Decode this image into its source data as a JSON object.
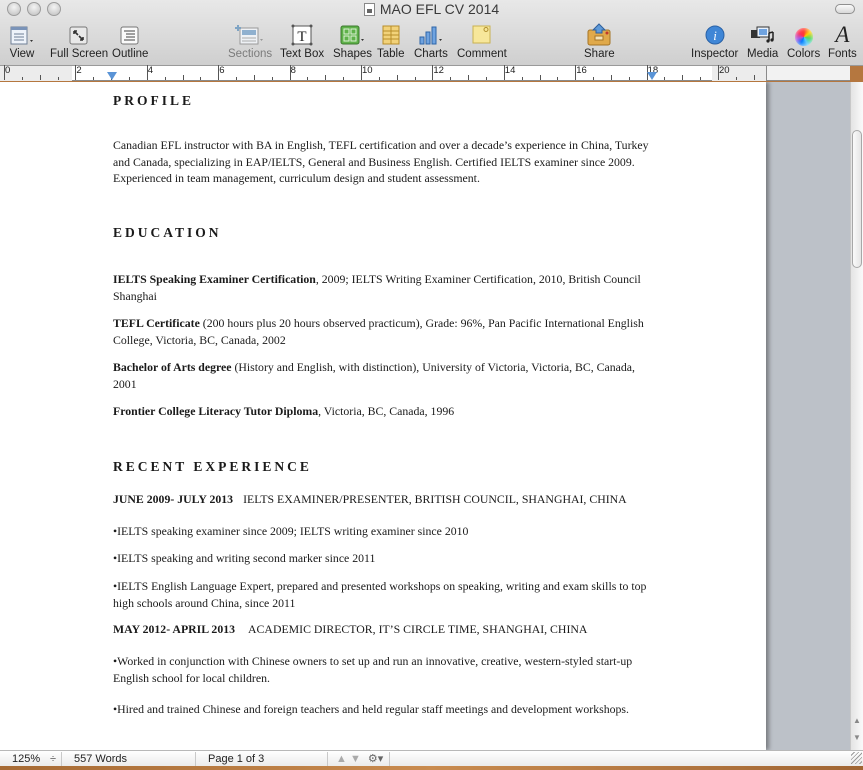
{
  "window": {
    "title": "MAO EFL CV 2014"
  },
  "toolbar": {
    "items": [
      {
        "id": "view",
        "label": "View",
        "icon": "view-icon"
      },
      {
        "id": "full-screen",
        "label": "Full Screen",
        "icon": "full-screen-icon"
      },
      {
        "id": "outline",
        "label": "Outline",
        "icon": "outline-icon"
      },
      {
        "id": "sections",
        "label": "Sections",
        "icon": "sections-icon",
        "disabled": true
      },
      {
        "id": "text-box",
        "label": "Text Box",
        "icon": "text-box-icon"
      },
      {
        "id": "shapes",
        "label": "Shapes",
        "icon": "shapes-icon"
      },
      {
        "id": "table",
        "label": "Table",
        "icon": "table-icon"
      },
      {
        "id": "charts",
        "label": "Charts",
        "icon": "charts-icon"
      },
      {
        "id": "comment",
        "label": "Comment",
        "icon": "comment-icon"
      },
      {
        "id": "share",
        "label": "Share",
        "icon": "share-icon"
      },
      {
        "id": "inspector",
        "label": "Inspector",
        "icon": "inspector-icon"
      },
      {
        "id": "media",
        "label": "Media",
        "icon": "media-icon"
      },
      {
        "id": "colors",
        "label": "Colors",
        "icon": "colors-icon"
      },
      {
        "id": "fonts",
        "label": "Fonts",
        "icon": "fonts-icon"
      }
    ],
    "colors": {
      "shapes_green": "#5fb24a",
      "table_yellow": "#f2d27a",
      "charts_blue": "#3f7fcf",
      "comment_yellow": "#f7e79a",
      "share_orange": "#e0a94a",
      "inspector_blue": "#3f86d6"
    }
  },
  "ruler": {
    "labels": [
      "0",
      "2",
      "4",
      "6",
      "8",
      "10",
      "12",
      "14",
      "16",
      "18",
      "20"
    ],
    "marker_color": "#5a94d6"
  },
  "document": {
    "sections": {
      "profile": {
        "heading": "PROFILE",
        "body": "Canadian EFL instructor with BA in English, TEFL certification and over a decade’s experience in China, Turkey and Canada,  specializing in EAP/IELTS, General and Business English. Certified IELTS examiner since 2009. Experienced in team management, curriculum design and student assessment."
      },
      "education": {
        "heading": "EDUCATION",
        "items": [
          {
            "bold": "IELTS Speaking Examiner Certification",
            "rest": ", 2009; IELTS Writing Examiner Certification, 2010, British Council Shanghai"
          },
          {
            "bold": "TEFL Certificate",
            "rest": " (200 hours plus 20 hours observed practicum), Grade: 96%, Pan Pacific International English College, Victoria, BC, Canada, 2002"
          },
          {
            "bold": "Bachelor of Arts degree",
            "rest": " (History and English, with distinction), University of Victoria, Victoria, BC, Canada, 2001"
          },
          {
            "bold": "Frontier College Literacy Tutor Diploma",
            "rest": ", Victoria, BC, Canada, 1996"
          }
        ]
      },
      "experience": {
        "heading": "RECENT EXPERIENCE",
        "jobs": [
          {
            "dates": "JUNE 2009- JULY 2013",
            "title": "IELTS EXAMINER/PRESENTER, BRITISH COUNCIL, SHANGHAI, CHINA",
            "bullets": [
              "•IELTS speaking examiner since 2009; IELTS writing examiner since 2010",
              "•IELTS speaking and writing second marker since 2011",
              "•IELTS English Language Expert, prepared and presented workshops on speaking, writing and exam skills to top high schools around China, since 2011"
            ]
          },
          {
            "dates": "MAY 2012- APRIL 2013",
            "title": "ACADEMIC DIRECTOR, IT’S CIRCLE TIME, SHANGHAI, CHINA",
            "bullets": [
              "•Worked in conjunction with Chinese owners to set up and run an innovative, creative, western-styled start-up English school for local children.",
              "•Hired and trained Chinese and foreign teachers and held regular staff meetings and development workshops."
            ]
          }
        ]
      }
    }
  },
  "statusbar": {
    "zoom": "125%",
    "zoom_stepper": "÷",
    "word_count": "557 Words",
    "page_indicator": "Page 1 of 3",
    "prev_page": "▲",
    "next_page": "▼",
    "action_menu": "⚙▾"
  }
}
